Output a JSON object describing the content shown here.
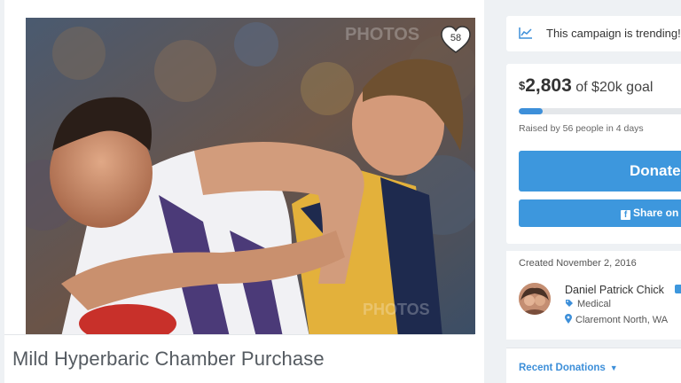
{
  "campaign": {
    "title": "Mild Hyperbaric Chamber Purchase",
    "hearts": "58",
    "photo_watermarks": [
      "PHOTOS",
      "PHOTOS"
    ]
  },
  "trending": {
    "icon": "trend-chart-icon",
    "text": "This campaign is trending!"
  },
  "funding": {
    "currency_symbol": "$",
    "raised": "2,803",
    "goal_text": "of $20k goal",
    "progress_fraction": 0.14,
    "sub_text": "Raised by 56 people in 4 days",
    "donate_label": "Donate",
    "share_label": "Share on",
    "share_icon": "facebook-icon"
  },
  "organizer": {
    "created": "Created November 2, 2016",
    "name": "Daniel Patrick Chick",
    "category": "Medical",
    "location": "Claremont North, WA"
  },
  "recent": {
    "label": "Recent Donations"
  },
  "colors": {
    "accent": "#3d97dd",
    "link": "#3d8fd9",
    "text": "#333333"
  }
}
